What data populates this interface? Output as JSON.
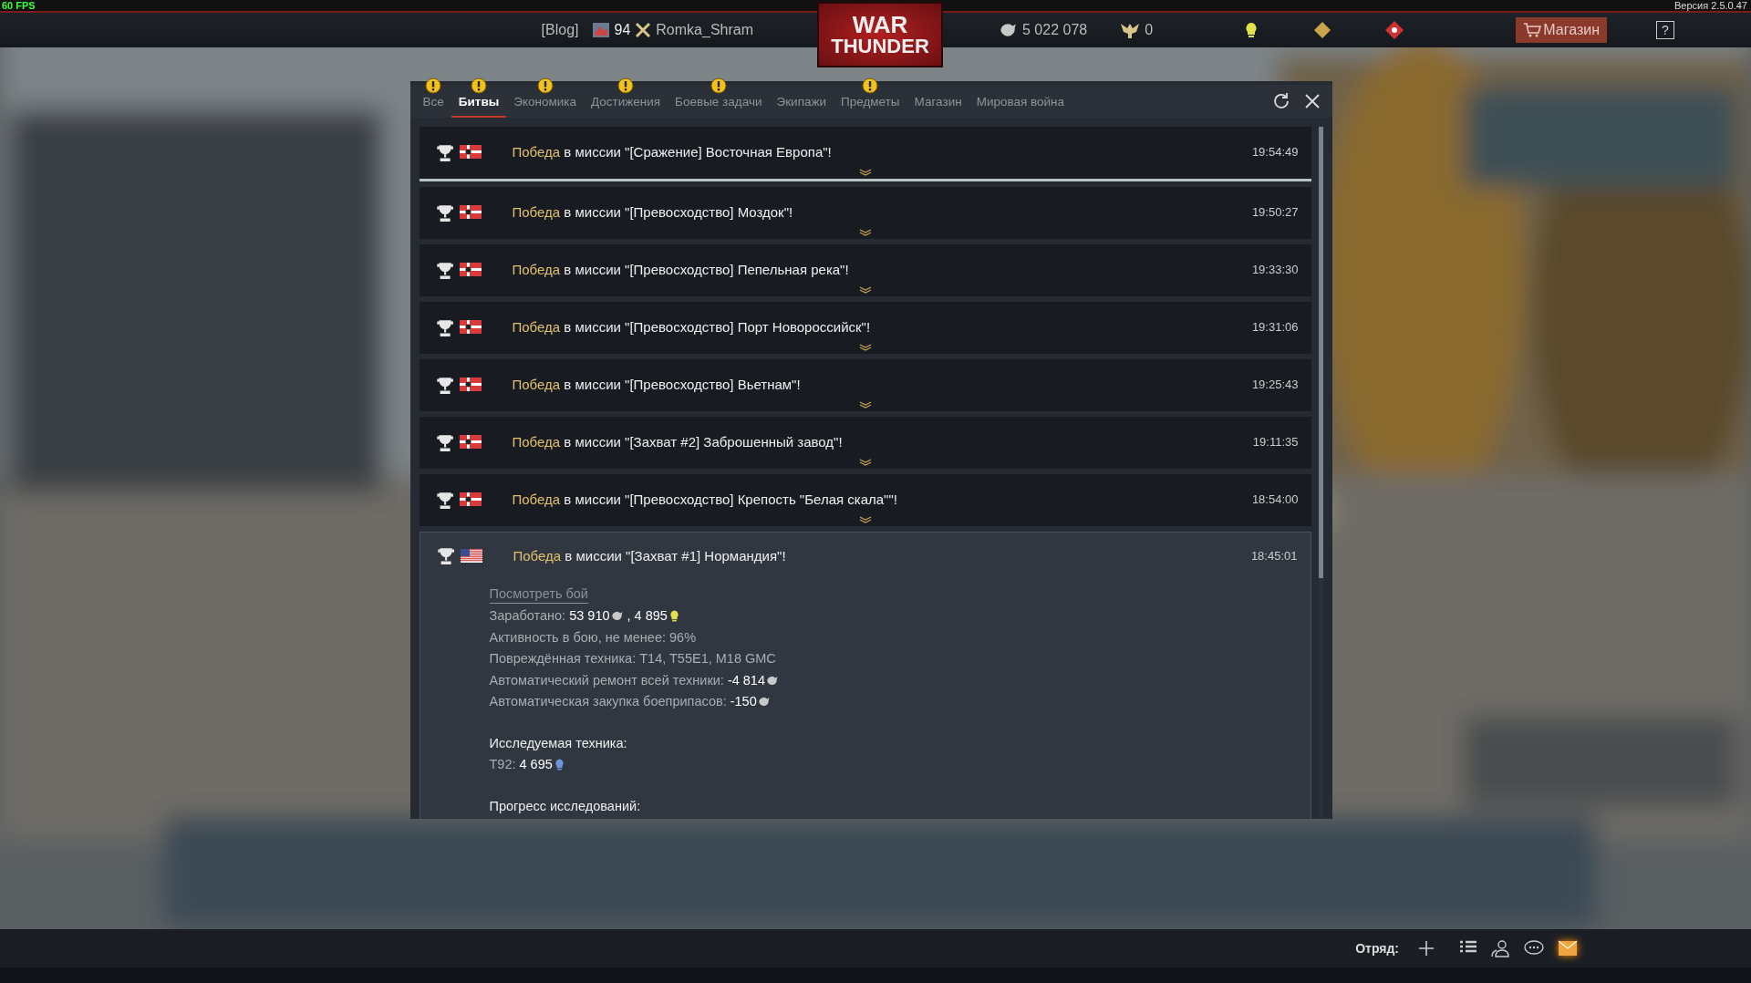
{
  "status_strip": {
    "fps": "60 FPS",
    "version": "Версия 2.5.0.47"
  },
  "top_bar": {
    "blog": "[Blog]",
    "rank": "94",
    "player": "Romka_Shram",
    "logo": [
      "WAR",
      "THUNDER"
    ],
    "silver": "5 022 078",
    "eagles": "0",
    "shop": "Магазин",
    "help": "?"
  },
  "tabs": [
    {
      "label": "Все",
      "selected": false,
      "alert": true
    },
    {
      "label": "Битвы",
      "selected": true,
      "alert": true
    },
    {
      "label": "Экономика",
      "selected": false,
      "alert": true
    },
    {
      "label": "Достижения",
      "selected": false,
      "alert": true
    },
    {
      "label": "Боевые задачи",
      "selected": false,
      "alert": true
    },
    {
      "label": "Экипажи",
      "selected": false,
      "alert": false
    },
    {
      "label": "Предметы",
      "selected": false,
      "alert": true
    },
    {
      "label": "Магазин",
      "selected": false,
      "alert": false
    },
    {
      "label": "Мировая война",
      "selected": false,
      "alert": false
    }
  ],
  "entries": [
    {
      "flag": {
        "kind": "germany"
      },
      "outcome": "Победа",
      "message": "в миссии \"[Сражение] Восточная Европа\"!",
      "time": "19:54:49",
      "expanded": false
    },
    {
      "flag": {
        "kind": "germany"
      },
      "outcome": "Победа",
      "message": "в миссии \"[Превосходство] Моздок\"!",
      "time": "19:50:27",
      "expanded": false
    },
    {
      "flag": {
        "kind": "germany"
      },
      "outcome": "Победа",
      "message": "в миссии \"[Превосходство] Пепельная река\"!",
      "time": "19:33:30",
      "expanded": false
    },
    {
      "flag": {
        "kind": "germany"
      },
      "outcome": "Победа",
      "message": "в миссии \"[Превосходство] Порт Новороссийск\"!",
      "time": "19:31:06",
      "expanded": false
    },
    {
      "flag": {
        "kind": "germany"
      },
      "outcome": "Победа",
      "message": "в миссии \"[Превосходство] Вьетнам\"!",
      "time": "19:25:43",
      "expanded": false
    },
    {
      "flag": {
        "kind": "germany"
      },
      "outcome": "Победа",
      "message": "в миссии \"[Захват #2] Заброшенный завод\"!",
      "time": "19:11:35",
      "expanded": false
    },
    {
      "flag": {
        "kind": "germany"
      },
      "outcome": "Победа",
      "message": "в миссии \"[Превосходство] Крепость \"Белая скала\"\"!",
      "time": "18:54:00",
      "expanded": false
    },
    {
      "flag": {
        "kind": "usa"
      },
      "outcome": "Победа",
      "message": "в миссии \"[Захват #1] Нормандия\"!",
      "time": "18:45:01",
      "expanded": true,
      "details": {
        "link": "Посмотреть бой",
        "sections": [
          {
            "lines": [
              {
                "label": "Заработано:",
                "values": [
                  {
                    "text": "53 910",
                    "kind": "silver"
                  },
                  {
                    "text": ", 4 895",
                    "kind": "rp"
                  }
                ]
              },
              {
                "label": "Активность в бою, не менее: 96%"
              },
              {
                "label": "Повреждённая техника: T14, T55E1, M18 GMC"
              },
              {
                "label": "Автоматический ремонт всей техники:",
                "values": [
                  {
                    "text": "-4 814",
                    "kind": "silver"
                  }
                ]
              },
              {
                "label": "Автоматическая закупка боеприпасов:",
                "values": [
                  {
                    "text": "-150",
                    "kind": "silver"
                  }
                ]
              }
            ]
          },
          {
            "heading": "Исследуемая техника:",
            "lines": [
              {
                "label": "T92:",
                "values": [
                  {
                    "text": "4 695",
                    "kind": "research"
                  }
                ]
              }
            ]
          },
          {
            "heading": "Прогресс исследований:"
          }
        ]
      }
    }
  ],
  "bottom_bar": {
    "squad": "Отряд:"
  }
}
